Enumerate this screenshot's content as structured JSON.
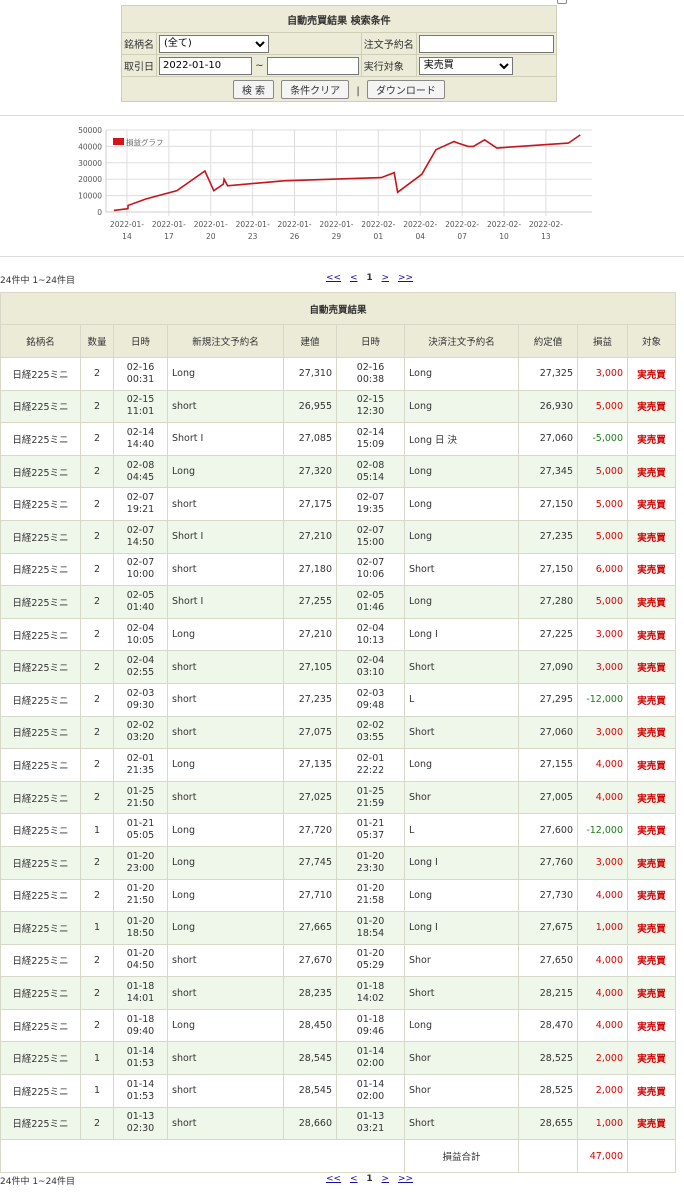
{
  "search": {
    "title": "自動売買結果 検索条件",
    "symbol_label": "銘柄名",
    "symbol_value": "(全て)",
    "order_name_label": "注文予約名",
    "order_name_value": "",
    "trade_date_label": "取引日",
    "date_from": "2022-01-10",
    "tilde": "~",
    "date_to": "",
    "exec_target_label": "実行対象",
    "exec_target_value": "実売買",
    "search_btn": "検 索",
    "clear_btn": "条件クリア",
    "separator": "|",
    "download_btn": "ダウンロード"
  },
  "chart_data": {
    "type": "line",
    "legend": "損益グラフ",
    "legend_color": "#d4141b",
    "line_color": "#c8141b",
    "ylim": [
      0,
      50000
    ],
    "yticks": [
      0,
      10000,
      20000,
      30000,
      40000,
      50000
    ],
    "xlabels": [
      [
        "2022-01-",
        "14"
      ],
      [
        "2022-01-",
        "17"
      ],
      [
        "2022-01-",
        "20"
      ],
      [
        "2022-01-",
        "23"
      ],
      [
        "2022-01-",
        "26"
      ],
      [
        "2022-01-",
        "29"
      ],
      [
        "2022-02-",
        "01"
      ],
      [
        "2022-02-",
        "04"
      ],
      [
        "2022-02-",
        "07"
      ],
      [
        "2022-02-",
        "10"
      ],
      [
        "2022-02-",
        "13"
      ]
    ],
    "x_range_days": [
      12.5,
      47.3
    ],
    "x_tick_days": [
      14,
      17,
      20,
      23,
      26,
      29,
      32,
      35,
      38,
      41,
      44
    ],
    "points": [
      [
        13.06,
        1000
      ],
      [
        14.07,
        2000
      ],
      [
        14.08,
        4000
      ],
      [
        15.38,
        8000
      ],
      [
        17.58,
        13000
      ],
      [
        19.58,
        25000
      ],
      [
        20.22,
        13000
      ],
      [
        20.9,
        17000
      ],
      [
        20.96,
        20000
      ],
      [
        21.21,
        16000
      ],
      [
        25.22,
        19000
      ],
      [
        32.22,
        21000
      ],
      [
        33.14,
        24000
      ],
      [
        33.38,
        12000
      ],
      [
        35.11,
        23000
      ],
      [
        36.12,
        38000
      ],
      [
        37.42,
        43000
      ],
      [
        37.71,
        42000
      ],
      [
        38.43,
        40000
      ],
      [
        38.81,
        40000
      ],
      [
        39.61,
        44000
      ],
      [
        40.48,
        39000
      ],
      [
        45.61,
        42000
      ],
      [
        46.46,
        47000
      ]
    ]
  },
  "pagination": {
    "count_text": "24件中 1~24件目",
    "first": "<<",
    "prev": "<",
    "current": "1",
    "next": ">",
    "last": ">>"
  },
  "results": {
    "caption": "自動売買結果",
    "headers": [
      "銘柄名",
      "数量",
      "日時",
      "新規注文予約名",
      "建値",
      "日時",
      "決済注文予約名",
      "約定値",
      "損益",
      "対象"
    ],
    "rows": [
      {
        "symbol": "日経225ミニ",
        "qty": "2",
        "open_d": "02-16",
        "open_t": "00:31",
        "open_name": "Long",
        "open_price": "27,310",
        "close_d": "02-16",
        "close_t": "00:38",
        "close_name": "Long",
        "close_price": "27,325",
        "pnl": "3,000",
        "target": "実売買"
      },
      {
        "symbol": "日経225ミニ",
        "qty": "2",
        "open_d": "02-15",
        "open_t": "11:01",
        "open_name": "short",
        "open_price": "26,955",
        "close_d": "02-15",
        "close_t": "12:30",
        "close_name": "Long",
        "close_price": "26,930",
        "pnl": "5,000",
        "target": "実売買"
      },
      {
        "symbol": "日経225ミニ",
        "qty": "2",
        "open_d": "02-14",
        "open_t": "14:40",
        "open_name": "Short I",
        "open_price": "27,085",
        "close_d": "02-14",
        "close_t": "15:09",
        "close_name": "Long 日  決",
        "close_price": "27,060",
        "pnl": "-5,000",
        "target": "実売買"
      },
      {
        "symbol": "日経225ミニ",
        "qty": "2",
        "open_d": "02-08",
        "open_t": "04:45",
        "open_name": "Long",
        "open_price": "27,320",
        "close_d": "02-08",
        "close_t": "05:14",
        "close_name": "Long",
        "close_price": "27,345",
        "pnl": "5,000",
        "target": "実売買"
      },
      {
        "symbol": "日経225ミニ",
        "qty": "2",
        "open_d": "02-07",
        "open_t": "19:21",
        "open_name": "short",
        "open_price": "27,175",
        "close_d": "02-07",
        "close_t": "19:35",
        "close_name": "Long",
        "close_price": "27,150",
        "pnl": "5,000",
        "target": "実売買"
      },
      {
        "symbol": "日経225ミニ",
        "qty": "2",
        "open_d": "02-07",
        "open_t": "14:50",
        "open_name": "Short I",
        "open_price": "27,210",
        "close_d": "02-07",
        "close_t": "15:00",
        "close_name": "Long",
        "close_price": "27,235",
        "pnl": "5,000",
        "target": "実売買"
      },
      {
        "symbol": "日経225ミニ",
        "qty": "2",
        "open_d": "02-07",
        "open_t": "10:00",
        "open_name": "short",
        "open_price": "27,180",
        "close_d": "02-07",
        "close_t": "10:06",
        "close_name": "Short",
        "close_price": "27,150",
        "pnl": "6,000",
        "target": "実売買"
      },
      {
        "symbol": "日経225ミニ",
        "qty": "2",
        "open_d": "02-05",
        "open_t": "01:40",
        "open_name": "Short I",
        "open_price": "27,255",
        "close_d": "02-05",
        "close_t": "01:46",
        "close_name": "Long",
        "close_price": "27,280",
        "pnl": "5,000",
        "target": "実売買"
      },
      {
        "symbol": "日経225ミニ",
        "qty": "2",
        "open_d": "02-04",
        "open_t": "10:05",
        "open_name": "Long",
        "open_price": "27,210",
        "close_d": "02-04",
        "close_t": "10:13",
        "close_name": "Long I",
        "close_price": "27,225",
        "pnl": "3,000",
        "target": "実売買"
      },
      {
        "symbol": "日経225ミニ",
        "qty": "2",
        "open_d": "02-04",
        "open_t": "02:55",
        "open_name": "short",
        "open_price": "27,105",
        "close_d": "02-04",
        "close_t": "03:10",
        "close_name": "Short",
        "close_price": "27,090",
        "pnl": "3,000",
        "target": "実売買"
      },
      {
        "symbol": "日経225ミニ",
        "qty": "2",
        "open_d": "02-03",
        "open_t": "09:30",
        "open_name": "short",
        "open_price": "27,235",
        "close_d": "02-03",
        "close_t": "09:48",
        "close_name": "L",
        "close_price": "27,295",
        "pnl": "-12,000",
        "target": "実売買"
      },
      {
        "symbol": "日経225ミニ",
        "qty": "2",
        "open_d": "02-02",
        "open_t": "03:20",
        "open_name": "short",
        "open_price": "27,075",
        "close_d": "02-02",
        "close_t": "03:55",
        "close_name": "Short",
        "close_price": "27,060",
        "pnl": "3,000",
        "target": "実売買"
      },
      {
        "symbol": "日経225ミニ",
        "qty": "2",
        "open_d": "02-01",
        "open_t": "21:35",
        "open_name": "Long",
        "open_price": "27,135",
        "close_d": "02-01",
        "close_t": "22:22",
        "close_name": "Long",
        "close_price": "27,155",
        "pnl": "4,000",
        "target": "実売買"
      },
      {
        "symbol": "日経225ミニ",
        "qty": "2",
        "open_d": "01-25",
        "open_t": "21:50",
        "open_name": "short",
        "open_price": "27,025",
        "close_d": "01-25",
        "close_t": "21:59",
        "close_name": "Shor",
        "close_price": "27,005",
        "pnl": "4,000",
        "target": "実売買"
      },
      {
        "symbol": "日経225ミニ",
        "qty": "1",
        "open_d": "01-21",
        "open_t": "05:05",
        "open_name": "Long",
        "open_price": "27,720",
        "close_d": "01-21",
        "close_t": "05:37",
        "close_name": "L",
        "close_price": "27,600",
        "pnl": "-12,000",
        "target": "実売買"
      },
      {
        "symbol": "日経225ミニ",
        "qty": "2",
        "open_d": "01-20",
        "open_t": "23:00",
        "open_name": "Long",
        "open_price": "27,745",
        "close_d": "01-20",
        "close_t": "23:30",
        "close_name": "Long I",
        "close_price": "27,760",
        "pnl": "3,000",
        "target": "実売買"
      },
      {
        "symbol": "日経225ミニ",
        "qty": "2",
        "open_d": "01-20",
        "open_t": "21:50",
        "open_name": "Long",
        "open_price": "27,710",
        "close_d": "01-20",
        "close_t": "21:58",
        "close_name": "Long",
        "close_price": "27,730",
        "pnl": "4,000",
        "target": "実売買"
      },
      {
        "symbol": "日経225ミニ",
        "qty": "1",
        "open_d": "01-20",
        "open_t": "18:50",
        "open_name": "Long",
        "open_price": "27,665",
        "close_d": "01-20",
        "close_t": "18:54",
        "close_name": "Long I",
        "close_price": "27,675",
        "pnl": "1,000",
        "target": "実売買"
      },
      {
        "symbol": "日経225ミニ",
        "qty": "2",
        "open_d": "01-20",
        "open_t": "04:50",
        "open_name": "short",
        "open_price": "27,670",
        "close_d": "01-20",
        "close_t": "05:29",
        "close_name": "Shor",
        "close_price": "27,650",
        "pnl": "4,000",
        "target": "実売買"
      },
      {
        "symbol": "日経225ミニ",
        "qty": "2",
        "open_d": "01-18",
        "open_t": "14:01",
        "open_name": "short",
        "open_price": "28,235",
        "close_d": "01-18",
        "close_t": "14:02",
        "close_name": "Short",
        "close_price": "28,215",
        "pnl": "4,000",
        "target": "実売買"
      },
      {
        "symbol": "日経225ミニ",
        "qty": "2",
        "open_d": "01-18",
        "open_t": "09:40",
        "open_name": "Long",
        "open_price": "28,450",
        "close_d": "01-18",
        "close_t": "09:46",
        "close_name": "Long",
        "close_price": "28,470",
        "pnl": "4,000",
        "target": "実売買"
      },
      {
        "symbol": "日経225ミニ",
        "qty": "1",
        "open_d": "01-14",
        "open_t": "01:53",
        "open_name": "short",
        "open_price": "28,545",
        "close_d": "01-14",
        "close_t": "02:00",
        "close_name": "Shor",
        "close_price": "28,525",
        "pnl": "2,000",
        "target": "実売買"
      },
      {
        "symbol": "日経225ミニ",
        "qty": "1",
        "open_d": "01-14",
        "open_t": "01:53",
        "open_name": "short",
        "open_price": "28,545",
        "close_d": "01-14",
        "close_t": "02:00",
        "close_name": "Shor",
        "close_price": "28,525",
        "pnl": "2,000",
        "target": "実売買"
      },
      {
        "symbol": "日経225ミニ",
        "qty": "2",
        "open_d": "01-13",
        "open_t": "02:30",
        "open_name": "short",
        "open_price": "28,660",
        "close_d": "01-13",
        "close_t": "03:21",
        "close_name": "Short",
        "close_price": "28,655",
        "pnl": "1,000",
        "target": "実売買"
      }
    ],
    "total_label": "損益合計",
    "total_value": "47,000"
  },
  "colors": {
    "panel_bg": "#ecebd8",
    "row_alt": "#eef7ea",
    "profit": "#e00000",
    "loss": "#1a7d1a",
    "link": "#1a0dab"
  }
}
